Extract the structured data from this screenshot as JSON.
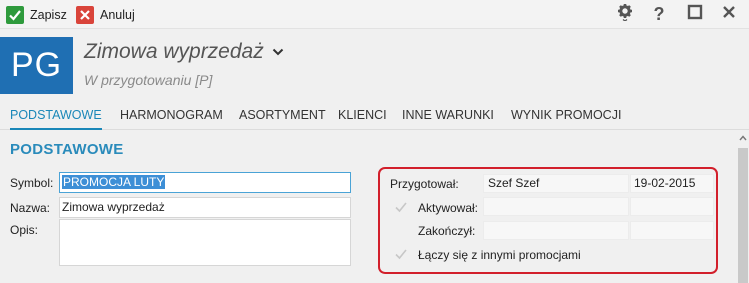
{
  "toolbar": {
    "save_label": "Zapisz",
    "cancel_label": "Anuluj",
    "save_color": "#2e9a3c",
    "cancel_color": "#d9443a"
  },
  "header": {
    "badge": "PG",
    "badge_color": "#1f6fb3",
    "title": "Zimowa wyprzedaż",
    "status": "W przygotowaniu [P]"
  },
  "tabs": [
    {
      "label": "PODSTAWOWE",
      "active": true
    },
    {
      "label": "HARMONOGRAM",
      "active": false
    },
    {
      "label": "ASORTYMENT",
      "active": false
    },
    {
      "label": "KLIENCI",
      "active": false
    },
    {
      "label": "INNE WARUNKI",
      "active": false
    },
    {
      "label": "WYNIK PROMOCJI",
      "active": false
    }
  ],
  "section": {
    "title": "PODSTAWOWE"
  },
  "form": {
    "symbol_label": "Symbol:",
    "symbol_value": "PROMOCJA LUTY",
    "name_label": "Nazwa:",
    "name_value": "Zimowa wyprzedaż",
    "desc_label": "Opis:",
    "desc_value": ""
  },
  "panel": {
    "prepared_label": "Przygotował:",
    "prepared_by": "Szef Szef",
    "prepared_date": "19-02-2015",
    "activated_label": "Aktywował:",
    "activated_by": "",
    "activated_date": "",
    "finished_label": "Zakończył:",
    "finished_by": "",
    "finished_date": "",
    "combine_label": "Łączy się z innymi promocjami",
    "highlight_color": "#d21f2b"
  }
}
